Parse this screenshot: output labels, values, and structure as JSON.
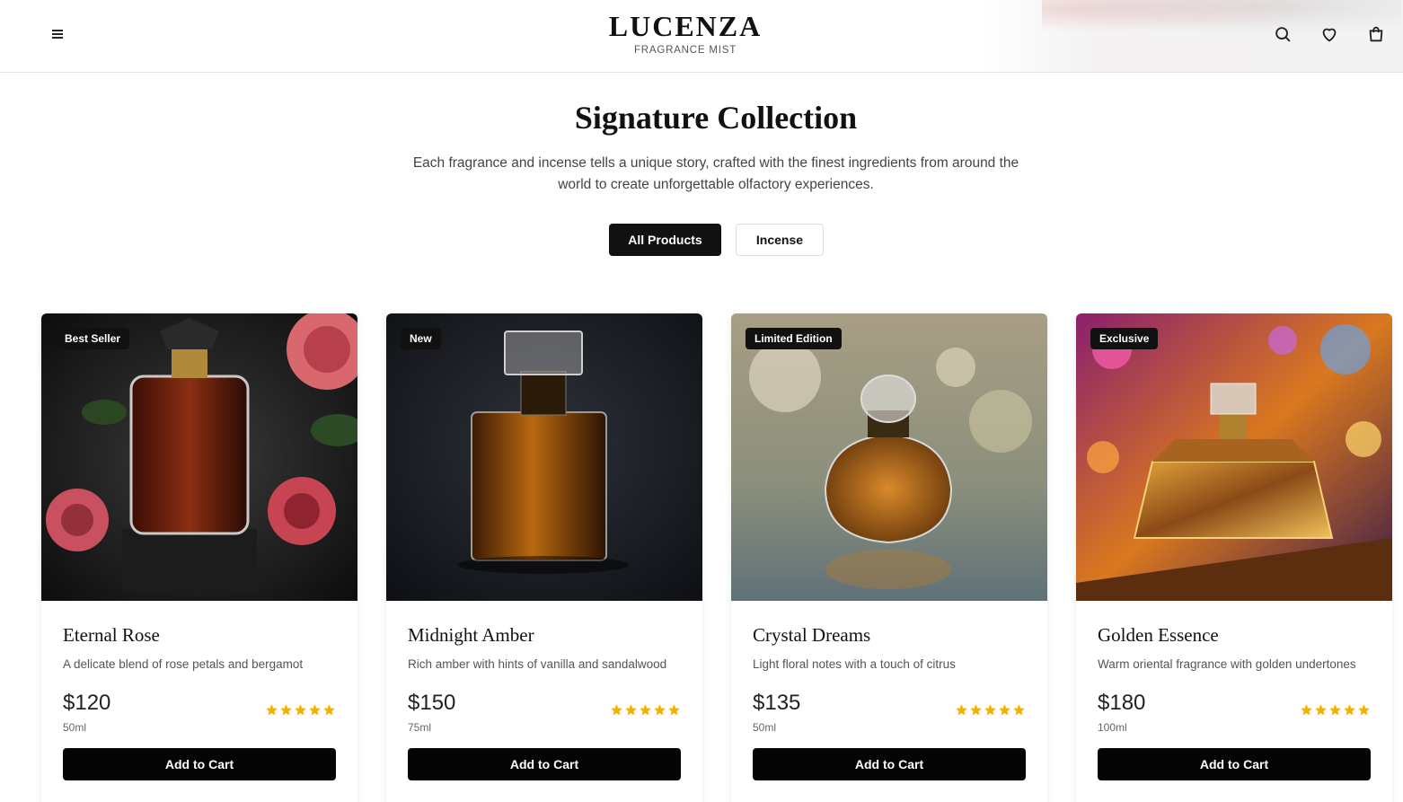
{
  "brand": {
    "name": "LUCENZA",
    "tagline": "FRAGRANCE MIST"
  },
  "header_icons": [
    "menu-icon",
    "search-icon",
    "heart-icon",
    "bag-icon"
  ],
  "section": {
    "title": "Signature Collection",
    "description": "Each fragrance and incense tells a unique story, crafted with the finest ingredients from around the world to create unforgettable olfactory experiences."
  },
  "filters": {
    "active": "All Products",
    "inactive": "Incense"
  },
  "accent_colors": {
    "primary": "#111111",
    "star": "#f5b301"
  },
  "products": [
    {
      "badge": "Best Seller",
      "name": "Eternal Rose",
      "description": "A delicate blend of rose petals and bergamot",
      "price": "$120",
      "size": "50ml",
      "rating": 5,
      "button": "Add to Cart"
    },
    {
      "badge": "New",
      "name": "Midnight Amber",
      "description": "Rich amber with hints of vanilla and sandalwood",
      "price": "$150",
      "size": "75ml",
      "rating": 5,
      "button": "Add to Cart"
    },
    {
      "badge": "Limited Edition",
      "name": "Crystal Dreams",
      "description": "Light floral notes with a touch of citrus",
      "price": "$135",
      "size": "50ml",
      "rating": 5,
      "button": "Add to Cart"
    },
    {
      "badge": "Exclusive",
      "name": "Golden Essence",
      "description": "Warm oriental fragrance with golden undertones",
      "price": "$180",
      "size": "100ml",
      "rating": 5,
      "button": "Add to Cart"
    }
  ]
}
